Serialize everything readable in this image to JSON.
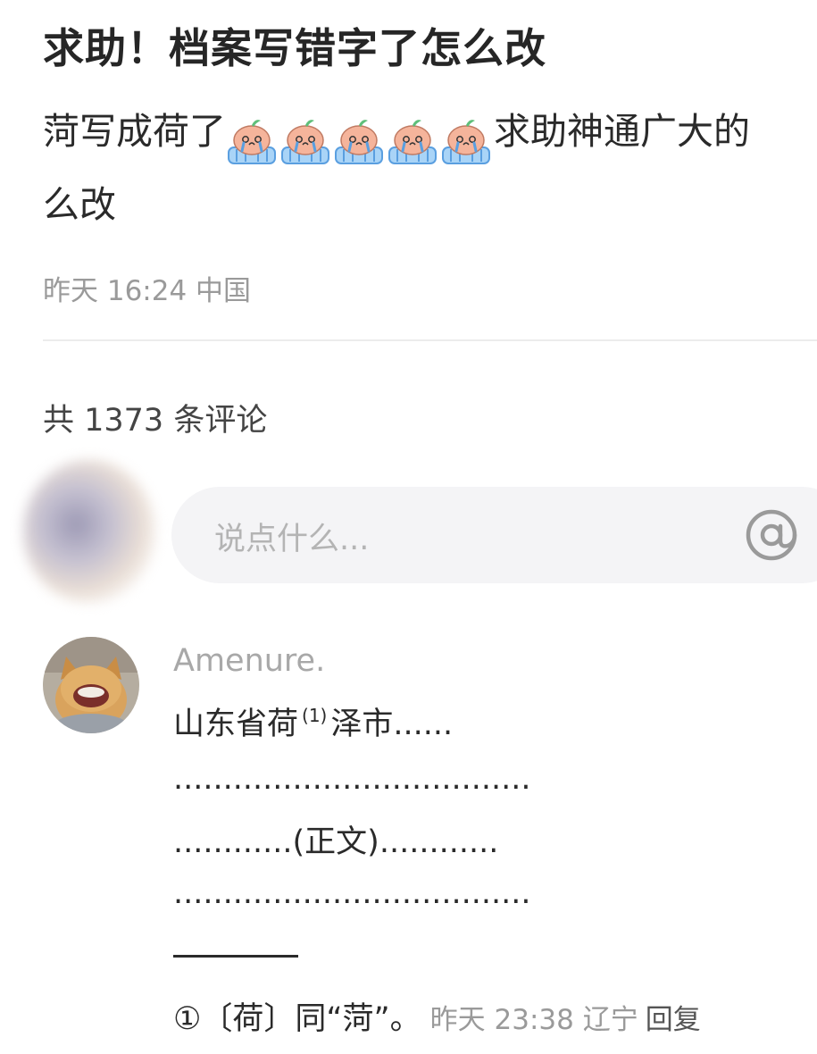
{
  "post": {
    "title": "求助！档案写错字了怎么改",
    "body_part1": "菏写成荷了",
    "body_part2": "求助神通广大的",
    "body_line2": "么改",
    "emoji_name": "crying-peach-emoji",
    "emoji_count": 5,
    "meta": "昨天 16:24 中国"
  },
  "comments_section": {
    "count_label": "共 1373 条评论",
    "input_placeholder": "说点什么...",
    "at_icon": "at-icon"
  },
  "comment": {
    "author": "Amenure.",
    "line1_a": "山东省荷",
    "line1_sup": "(1)",
    "line1_b": "泽市......",
    "line2": "....................................",
    "line3": "............(正文)............",
    "line4": "....................................",
    "footnote": "①〔荷〕同“菏”。",
    "time": "昨天 23:38",
    "location": "辽宁",
    "reply_label": "回复"
  },
  "colors": {
    "title": "#262626",
    "meta": "#9a9a9a",
    "input_bg": "#f4f4f6",
    "divider": "#ececec"
  }
}
